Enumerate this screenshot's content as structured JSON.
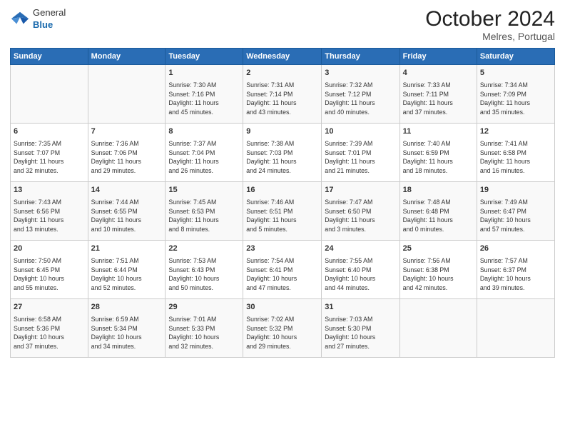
{
  "header": {
    "logo_general": "General",
    "logo_blue": "Blue",
    "month_year": "October 2024",
    "location": "Melres, Portugal"
  },
  "weekdays": [
    "Sunday",
    "Monday",
    "Tuesday",
    "Wednesday",
    "Thursday",
    "Friday",
    "Saturday"
  ],
  "weeks": [
    [
      {
        "day": "",
        "info": ""
      },
      {
        "day": "",
        "info": ""
      },
      {
        "day": "1",
        "info": "Sunrise: 7:30 AM\nSunset: 7:16 PM\nDaylight: 11 hours\nand 45 minutes."
      },
      {
        "day": "2",
        "info": "Sunrise: 7:31 AM\nSunset: 7:14 PM\nDaylight: 11 hours\nand 43 minutes."
      },
      {
        "day": "3",
        "info": "Sunrise: 7:32 AM\nSunset: 7:12 PM\nDaylight: 11 hours\nand 40 minutes."
      },
      {
        "day": "4",
        "info": "Sunrise: 7:33 AM\nSunset: 7:11 PM\nDaylight: 11 hours\nand 37 minutes."
      },
      {
        "day": "5",
        "info": "Sunrise: 7:34 AM\nSunset: 7:09 PM\nDaylight: 11 hours\nand 35 minutes."
      }
    ],
    [
      {
        "day": "6",
        "info": "Sunrise: 7:35 AM\nSunset: 7:07 PM\nDaylight: 11 hours\nand 32 minutes."
      },
      {
        "day": "7",
        "info": "Sunrise: 7:36 AM\nSunset: 7:06 PM\nDaylight: 11 hours\nand 29 minutes."
      },
      {
        "day": "8",
        "info": "Sunrise: 7:37 AM\nSunset: 7:04 PM\nDaylight: 11 hours\nand 26 minutes."
      },
      {
        "day": "9",
        "info": "Sunrise: 7:38 AM\nSunset: 7:03 PM\nDaylight: 11 hours\nand 24 minutes."
      },
      {
        "day": "10",
        "info": "Sunrise: 7:39 AM\nSunset: 7:01 PM\nDaylight: 11 hours\nand 21 minutes."
      },
      {
        "day": "11",
        "info": "Sunrise: 7:40 AM\nSunset: 6:59 PM\nDaylight: 11 hours\nand 18 minutes."
      },
      {
        "day": "12",
        "info": "Sunrise: 7:41 AM\nSunset: 6:58 PM\nDaylight: 11 hours\nand 16 minutes."
      }
    ],
    [
      {
        "day": "13",
        "info": "Sunrise: 7:43 AM\nSunset: 6:56 PM\nDaylight: 11 hours\nand 13 minutes."
      },
      {
        "day": "14",
        "info": "Sunrise: 7:44 AM\nSunset: 6:55 PM\nDaylight: 11 hours\nand 10 minutes."
      },
      {
        "day": "15",
        "info": "Sunrise: 7:45 AM\nSunset: 6:53 PM\nDaylight: 11 hours\nand 8 minutes."
      },
      {
        "day": "16",
        "info": "Sunrise: 7:46 AM\nSunset: 6:51 PM\nDaylight: 11 hours\nand 5 minutes."
      },
      {
        "day": "17",
        "info": "Sunrise: 7:47 AM\nSunset: 6:50 PM\nDaylight: 11 hours\nand 3 minutes."
      },
      {
        "day": "18",
        "info": "Sunrise: 7:48 AM\nSunset: 6:48 PM\nDaylight: 11 hours\nand 0 minutes."
      },
      {
        "day": "19",
        "info": "Sunrise: 7:49 AM\nSunset: 6:47 PM\nDaylight: 10 hours\nand 57 minutes."
      }
    ],
    [
      {
        "day": "20",
        "info": "Sunrise: 7:50 AM\nSunset: 6:45 PM\nDaylight: 10 hours\nand 55 minutes."
      },
      {
        "day": "21",
        "info": "Sunrise: 7:51 AM\nSunset: 6:44 PM\nDaylight: 10 hours\nand 52 minutes."
      },
      {
        "day": "22",
        "info": "Sunrise: 7:53 AM\nSunset: 6:43 PM\nDaylight: 10 hours\nand 50 minutes."
      },
      {
        "day": "23",
        "info": "Sunrise: 7:54 AM\nSunset: 6:41 PM\nDaylight: 10 hours\nand 47 minutes."
      },
      {
        "day": "24",
        "info": "Sunrise: 7:55 AM\nSunset: 6:40 PM\nDaylight: 10 hours\nand 44 minutes."
      },
      {
        "day": "25",
        "info": "Sunrise: 7:56 AM\nSunset: 6:38 PM\nDaylight: 10 hours\nand 42 minutes."
      },
      {
        "day": "26",
        "info": "Sunrise: 7:57 AM\nSunset: 6:37 PM\nDaylight: 10 hours\nand 39 minutes."
      }
    ],
    [
      {
        "day": "27",
        "info": "Sunrise: 6:58 AM\nSunset: 5:36 PM\nDaylight: 10 hours\nand 37 minutes."
      },
      {
        "day": "28",
        "info": "Sunrise: 6:59 AM\nSunset: 5:34 PM\nDaylight: 10 hours\nand 34 minutes."
      },
      {
        "day": "29",
        "info": "Sunrise: 7:01 AM\nSunset: 5:33 PM\nDaylight: 10 hours\nand 32 minutes."
      },
      {
        "day": "30",
        "info": "Sunrise: 7:02 AM\nSunset: 5:32 PM\nDaylight: 10 hours\nand 29 minutes."
      },
      {
        "day": "31",
        "info": "Sunrise: 7:03 AM\nSunset: 5:30 PM\nDaylight: 10 hours\nand 27 minutes."
      },
      {
        "day": "",
        "info": ""
      },
      {
        "day": "",
        "info": ""
      }
    ]
  ]
}
